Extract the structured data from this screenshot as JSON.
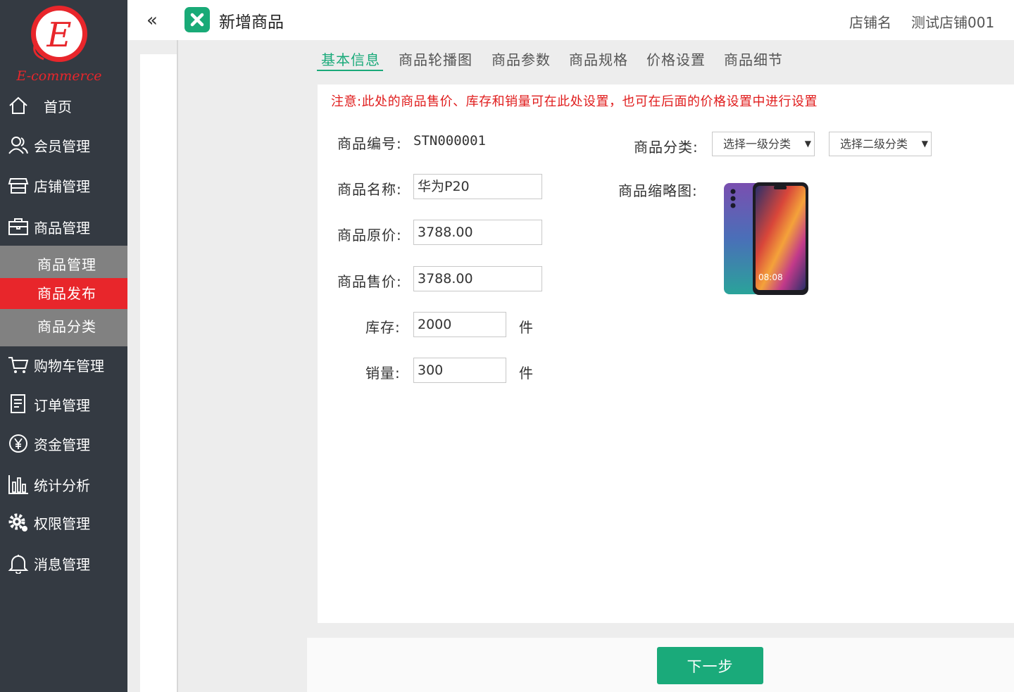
{
  "app": {
    "logo_text": "E-commerce",
    "logo_letter": "E"
  },
  "sidebar": {
    "items": [
      {
        "label": "首页",
        "icon": "home-icon"
      },
      {
        "label": "会员管理",
        "icon": "users-icon"
      },
      {
        "label": "店铺管理",
        "icon": "store-icon"
      },
      {
        "label": "商品管理",
        "icon": "briefcase-icon"
      },
      {
        "label": "购物车管理",
        "icon": "cart-icon"
      },
      {
        "label": "订单管理",
        "icon": "order-icon"
      },
      {
        "label": "资金管理",
        "icon": "yen-icon"
      },
      {
        "label": "统计分析",
        "icon": "chart-icon"
      },
      {
        "label": "权限管理",
        "icon": "gear-icon"
      },
      {
        "label": "消息管理",
        "icon": "bell-icon"
      }
    ],
    "submenu": [
      {
        "label": "商品管理"
      },
      {
        "label": "商品发布",
        "active": true
      },
      {
        "label": "商品分类"
      }
    ],
    "collapse_icon": "«"
  },
  "header": {
    "title": "新增商品",
    "store_label": "店铺名",
    "store_name": "测试店铺001",
    "icon": "close-icon"
  },
  "tabs": [
    {
      "label": "基本信息",
      "active": true
    },
    {
      "label": "商品轮播图"
    },
    {
      "label": "商品参数"
    },
    {
      "label": "商品规格"
    },
    {
      "label": "价格设置"
    },
    {
      "label": "商品细节"
    }
  ],
  "form": {
    "notice": "注意:此处的商品售价、库存和销量可在此处设置，也可在后面的价格设置中进行设置",
    "code_label": "商品编号:",
    "code_value": "STN000001",
    "name_label": "商品名称:",
    "name_value": "华为P20",
    "orig_price_label": "商品原价:",
    "orig_price_value": "3788.00",
    "sale_price_label": "商品售价:",
    "sale_price_value": "3788.00",
    "stock_label": "库存:",
    "stock_value": "2000",
    "stock_unit": "件",
    "sales_label": "销量:",
    "sales_value": "300",
    "sales_unit": "件",
    "category_label": "商品分类:",
    "category1_placeholder": "选择一级分类",
    "category2_placeholder": "选择二级分类",
    "thumbnail_label": "商品缩略图:",
    "phone_screen_time": "08:08"
  },
  "footer": {
    "next_label": "下一步"
  },
  "colors": {
    "accent": "#1aaa7a",
    "sidebar_bg": "#343a42",
    "active_red": "#e8262b",
    "notice_red": "#e01c1c"
  }
}
